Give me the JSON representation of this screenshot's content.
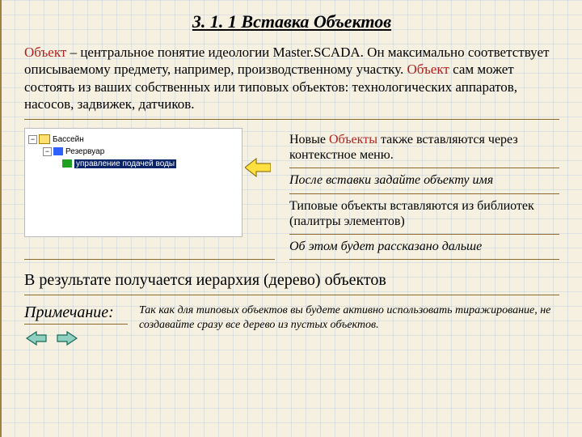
{
  "title": "3. 1. 1 Вставка  Объектов",
  "intro": {
    "kw1": "Объект",
    "part1": " – центральное понятие идеологии Master.SCADA. Он максимально соответствует описываемому предмету, например, производственному участку. ",
    "kw2": "Объект",
    "part2": " сам может состоять из ваших собственных или типовых объектов: технологических аппаратов, насосов, задвижек, датчиков."
  },
  "tree": {
    "l1": "Бассейн",
    "l2": "Резервуар",
    "l3": "управление подачей воды"
  },
  "right": {
    "b1a": "Новые ",
    "b1kw": "Объекты",
    "b1b": " также вставляются через контекстное меню.",
    "b2": "После вставки задайте объекту имя",
    "b3": "Типовые объекты вставляются из библиотек (палитры элементов)",
    "b4": "Об этом будет рассказано дальше"
  },
  "result": "В результате получается иерархия  (дерево) объектов",
  "note": {
    "label": "Примечание:",
    "text": "Так как для типовых объектов вы будете активно использовать тиражирование, не создавайте сразу все дерево из пустых объектов."
  }
}
